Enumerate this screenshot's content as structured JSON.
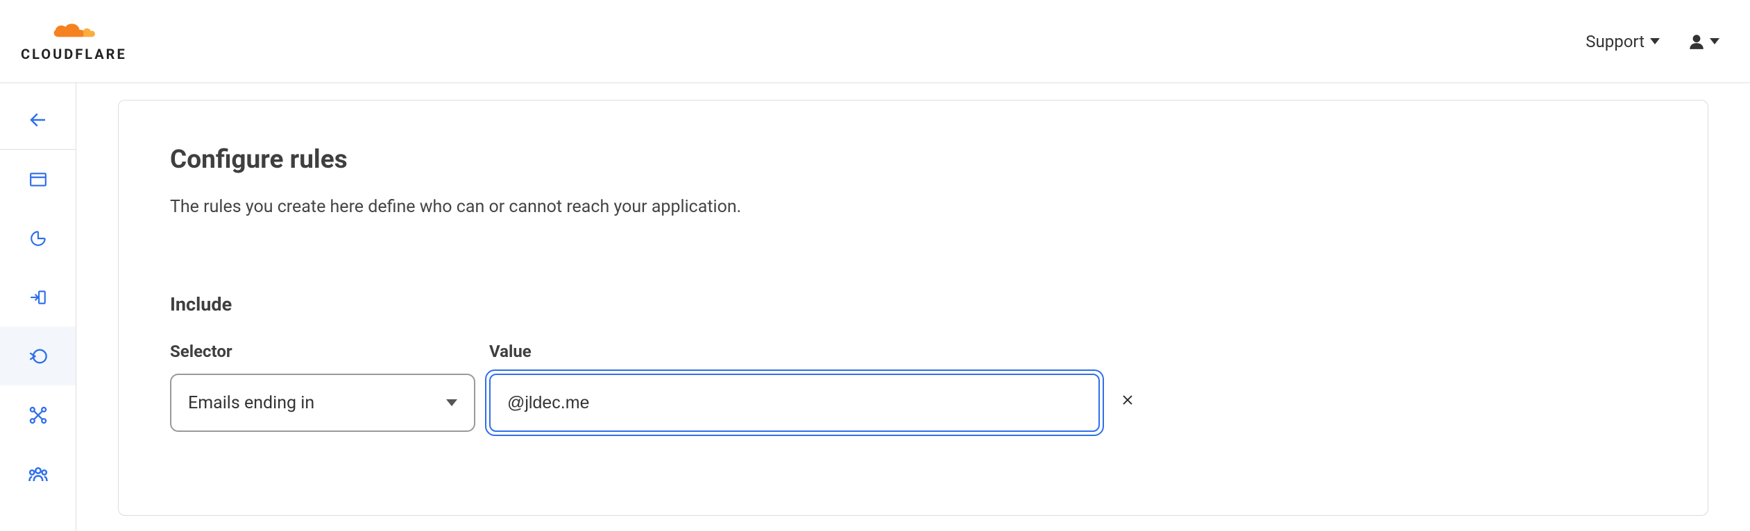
{
  "header": {
    "logo_text": "CLOUDFLARE",
    "support_label": "Support"
  },
  "card": {
    "title": "Configure rules",
    "description": "The rules you create here define who can or cannot reach your application."
  },
  "include_section": {
    "title": "Include",
    "selector_label": "Selector",
    "value_label": "Value",
    "selector_value": "Emails ending in",
    "value_input": "@jldec.me"
  }
}
